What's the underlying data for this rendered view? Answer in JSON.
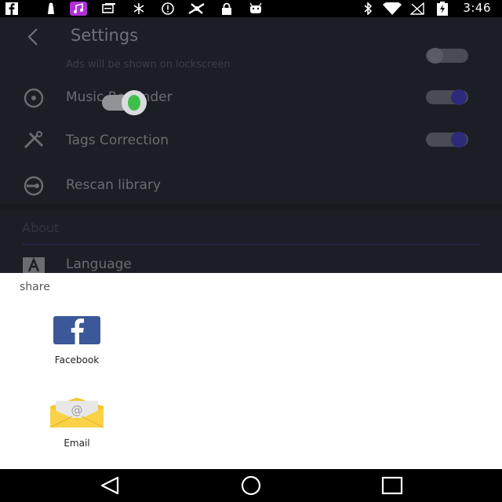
{
  "status_bar": {
    "time": "3:46",
    "left_icons": [
      "facebook-icon",
      "android-icon",
      "music-app-icon",
      "cards-icon",
      "sync-icon",
      "alert-icon",
      "fan-icon",
      "lock-icon",
      "android-robot-icon"
    ],
    "right_icons": [
      "bluetooth-icon",
      "wifi-icon",
      "signal-off-icon",
      "battery-charging-icon"
    ]
  },
  "settings": {
    "title": "Settings",
    "ads_subtitle": "Ads will be shown on lockscreen",
    "rows": [
      {
        "label": "Music Reminder",
        "icon": "music-disc-icon",
        "toggle": "on"
      },
      {
        "label": "Tags Correction",
        "icon": "tools-icon",
        "toggle": "on"
      },
      {
        "label": "Rescan library",
        "icon": "rescan-icon"
      }
    ],
    "about_header": "About",
    "language_label": "Language",
    "colors": {
      "background": "#1c1e26",
      "accent": "#2d2a7a"
    }
  },
  "share": {
    "title": "share",
    "items": [
      {
        "label": "Facebook",
        "icon": "facebook-app-icon",
        "color": "#3b5998"
      },
      {
        "label": "Email",
        "icon": "email-app-icon",
        "color": "#f6c633"
      }
    ]
  },
  "nav_bar": {
    "buttons": [
      "back-triangle-icon",
      "home-circle-icon",
      "recents-square-icon"
    ]
  }
}
